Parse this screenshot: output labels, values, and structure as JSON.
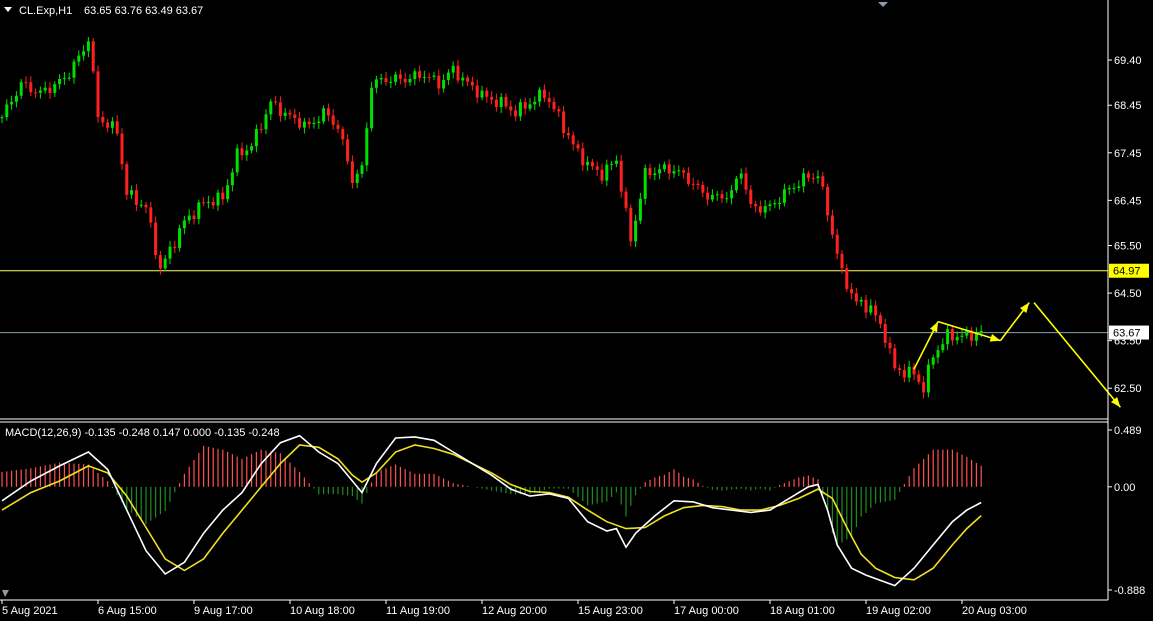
{
  "chart_header": {
    "symbol": "CL.Exp,H1",
    "ohlc": "63.65 63.76 63.49 63.67"
  },
  "macd_header": {
    "text": "MACD(12,26,9) -0.135 -0.248 0.147 0.000 -0.135 -0.248"
  },
  "colors": {
    "background": "#000000",
    "bull": "#00e000",
    "bear": "#ff2020",
    "hist_pos": "#ff5050",
    "hist_neg": "#1e8c1e",
    "macd_line": "#ffffff",
    "signal_line": "#f0e020",
    "hline": "#ffff66",
    "current_line": "#8aa0b0",
    "arrow": "#ffff00",
    "axis": "#ffffff"
  },
  "chart_data": [
    {
      "type": "candlestick",
      "timeframe": "H1",
      "ylim": [
        62.0,
        70.2
      ],
      "y_ticks": [
        "69.40",
        "68.45",
        "67.45",
        "66.45",
        "65.50",
        "64.50",
        "63.50",
        "62.50"
      ],
      "x_ticks": [
        "5 Aug 2021",
        "6 Aug 15:00",
        "9 Aug 17:00",
        "10 Aug 18:00",
        "11 Aug 19:00",
        "12 Aug 20:00",
        "15 Aug 23:00",
        "17 Aug 00:00",
        "18 Aug 01:00",
        "19 Aug 02:00",
        "20 Aug 03:00"
      ],
      "key_points": [
        {
          "t": 0.0,
          "v": 68.2
        },
        {
          "t": 4.0,
          "v": 68.9
        },
        {
          "t": 8.0,
          "v": 68.7
        },
        {
          "t": 13.0,
          "v": 69.0
        },
        {
          "t": 17.0,
          "v": 69.6
        },
        {
          "t": 18.0,
          "v": 69.9
        },
        {
          "t": 20.0,
          "v": 68.2
        },
        {
          "t": 24.0,
          "v": 67.9
        },
        {
          "t": 26.0,
          "v": 66.6
        },
        {
          "t": 30.0,
          "v": 66.3
        },
        {
          "t": 33.0,
          "v": 65.0
        },
        {
          "t": 35.0,
          "v": 65.4
        },
        {
          "t": 38.0,
          "v": 66.0
        },
        {
          "t": 42.0,
          "v": 66.4
        },
        {
          "t": 46.0,
          "v": 66.5
        },
        {
          "t": 49.0,
          "v": 67.4
        },
        {
          "t": 52.0,
          "v": 67.6
        },
        {
          "t": 56.0,
          "v": 68.5
        },
        {
          "t": 60.0,
          "v": 68.2
        },
        {
          "t": 64.0,
          "v": 68.0
        },
        {
          "t": 67.0,
          "v": 68.3
        },
        {
          "t": 70.0,
          "v": 68.0
        },
        {
          "t": 73.0,
          "v": 66.9
        },
        {
          "t": 75.0,
          "v": 67.1
        },
        {
          "t": 77.0,
          "v": 68.9
        },
        {
          "t": 80.0,
          "v": 69.0
        },
        {
          "t": 84.0,
          "v": 69.0
        },
        {
          "t": 88.0,
          "v": 69.1
        },
        {
          "t": 91.0,
          "v": 68.9
        },
        {
          "t": 94.0,
          "v": 69.2
        },
        {
          "t": 97.0,
          "v": 68.9
        },
        {
          "t": 101.0,
          "v": 68.6
        },
        {
          "t": 104.0,
          "v": 68.5
        },
        {
          "t": 107.0,
          "v": 68.3
        },
        {
          "t": 110.0,
          "v": 68.5
        },
        {
          "t": 113.0,
          "v": 68.7
        },
        {
          "t": 116.0,
          "v": 68.2
        },
        {
          "t": 119.0,
          "v": 67.6
        },
        {
          "t": 122.0,
          "v": 67.2
        },
        {
          "t": 125.0,
          "v": 67.0
        },
        {
          "t": 128.0,
          "v": 67.3
        },
        {
          "t": 131.0,
          "v": 65.6
        },
        {
          "t": 134.0,
          "v": 67.0
        },
        {
          "t": 137.0,
          "v": 67.1
        },
        {
          "t": 140.0,
          "v": 67.1
        },
        {
          "t": 143.0,
          "v": 66.9
        },
        {
          "t": 146.0,
          "v": 66.6
        },
        {
          "t": 149.0,
          "v": 66.5
        },
        {
          "t": 152.0,
          "v": 66.6
        },
        {
          "t": 154.0,
          "v": 67.1
        },
        {
          "t": 156.0,
          "v": 66.3
        },
        {
          "t": 160.0,
          "v": 66.3
        },
        {
          "t": 163.0,
          "v": 66.6
        },
        {
          "t": 167.0,
          "v": 66.9
        },
        {
          "t": 170.0,
          "v": 67.0
        },
        {
          "t": 172.0,
          "v": 66.2
        },
        {
          "t": 175.0,
          "v": 64.9
        },
        {
          "t": 178.0,
          "v": 64.3
        },
        {
          "t": 181.0,
          "v": 64.2
        },
        {
          "t": 184.0,
          "v": 63.6
        },
        {
          "t": 186.0,
          "v": 62.9
        },
        {
          "t": 190.0,
          "v": 62.8
        },
        {
          "t": 192.0,
          "v": 62.5
        },
        {
          "t": 194.0,
          "v": 63.2
        },
        {
          "t": 197.0,
          "v": 63.6
        },
        {
          "t": 201.0,
          "v": 63.6
        },
        {
          "t": 204.0,
          "v": 63.67
        }
      ],
      "horizontal_lines": [
        {
          "value": 64.97,
          "label": "64.97",
          "style": "yellow"
        },
        {
          "value": 63.67,
          "label": "63.67",
          "style": "current-price"
        }
      ],
      "projection_arrows": [
        [
          {
            "t": 190.0,
            "v": 62.9
          },
          {
            "t": 195.0,
            "v": 63.9
          }
        ],
        [
          {
            "t": 195.0,
            "v": 63.9
          },
          {
            "t": 208.0,
            "v": 63.5
          }
        ],
        [
          {
            "t": 208.0,
            "v": 63.5
          },
          {
            "t": 214.0,
            "v": 64.3
          }
        ],
        [
          {
            "t": 215.0,
            "v": 64.3
          },
          {
            "t": 233.0,
            "v": 62.1
          }
        ]
      ]
    },
    {
      "type": "line",
      "name": "MACD(12,26,9)",
      "ylim": [
        -0.888,
        0.489
      ],
      "y_ticks": [
        "0.489",
        "0.00",
        "-0.888"
      ],
      "macd_points": [
        {
          "t": 0,
          "v": -0.12
        },
        {
          "t": 6,
          "v": 0.05
        },
        {
          "t": 12,
          "v": 0.18
        },
        {
          "t": 18,
          "v": 0.3
        },
        {
          "t": 22,
          "v": 0.15
        },
        {
          "t": 26,
          "v": -0.2
        },
        {
          "t": 30,
          "v": -0.55
        },
        {
          "t": 34,
          "v": -0.75
        },
        {
          "t": 38,
          "v": -0.65
        },
        {
          "t": 42,
          "v": -0.4
        },
        {
          "t": 46,
          "v": -0.2
        },
        {
          "t": 50,
          "v": -0.05
        },
        {
          "t": 54,
          "v": 0.2
        },
        {
          "t": 58,
          "v": 0.38
        },
        {
          "t": 62,
          "v": 0.44
        },
        {
          "t": 66,
          "v": 0.3
        },
        {
          "t": 70,
          "v": 0.2
        },
        {
          "t": 73,
          "v": 0.05
        },
        {
          "t": 75,
          "v": -0.05
        },
        {
          "t": 78,
          "v": 0.2
        },
        {
          "t": 82,
          "v": 0.42
        },
        {
          "t": 86,
          "v": 0.43
        },
        {
          "t": 90,
          "v": 0.4
        },
        {
          "t": 94,
          "v": 0.3
        },
        {
          "t": 98,
          "v": 0.2
        },
        {
          "t": 102,
          "v": 0.1
        },
        {
          "t": 106,
          "v": -0.02
        },
        {
          "t": 110,
          "v": -0.08
        },
        {
          "t": 114,
          "v": -0.06
        },
        {
          "t": 118,
          "v": -0.1
        },
        {
          "t": 122,
          "v": -0.3
        },
        {
          "t": 126,
          "v": -0.38
        },
        {
          "t": 128,
          "v": -0.36
        },
        {
          "t": 130,
          "v": -0.52
        },
        {
          "t": 132,
          "v": -0.4
        },
        {
          "t": 136,
          "v": -0.25
        },
        {
          "t": 140,
          "v": -0.12
        },
        {
          "t": 144,
          "v": -0.13
        },
        {
          "t": 148,
          "v": -0.18
        },
        {
          "t": 152,
          "v": -0.2
        },
        {
          "t": 156,
          "v": -0.22
        },
        {
          "t": 160,
          "v": -0.2
        },
        {
          "t": 164,
          "v": -0.1
        },
        {
          "t": 168,
          "v": 0.0
        },
        {
          "t": 170,
          "v": 0.02
        },
        {
          "t": 172,
          "v": -0.2
        },
        {
          "t": 174,
          "v": -0.5
        },
        {
          "t": 177,
          "v": -0.7
        },
        {
          "t": 180,
          "v": -0.76
        },
        {
          "t": 184,
          "v": -0.82
        },
        {
          "t": 186,
          "v": -0.85
        },
        {
          "t": 190,
          "v": -0.7
        },
        {
          "t": 194,
          "v": -0.5
        },
        {
          "t": 198,
          "v": -0.3
        },
        {
          "t": 201,
          "v": -0.2
        },
        {
          "t": 204,
          "v": -0.135
        }
      ],
      "signal_points": [
        {
          "t": 0,
          "v": -0.2
        },
        {
          "t": 6,
          "v": -0.05
        },
        {
          "t": 12,
          "v": 0.05
        },
        {
          "t": 18,
          "v": 0.18
        },
        {
          "t": 22,
          "v": 0.12
        },
        {
          "t": 26,
          "v": -0.08
        },
        {
          "t": 30,
          "v": -0.35
        },
        {
          "t": 34,
          "v": -0.62
        },
        {
          "t": 38,
          "v": -0.72
        },
        {
          "t": 42,
          "v": -0.62
        },
        {
          "t": 46,
          "v": -0.4
        },
        {
          "t": 50,
          "v": -0.2
        },
        {
          "t": 54,
          "v": 0.0
        },
        {
          "t": 58,
          "v": 0.2
        },
        {
          "t": 62,
          "v": 0.36
        },
        {
          "t": 66,
          "v": 0.34
        },
        {
          "t": 70,
          "v": 0.24
        },
        {
          "t": 73,
          "v": 0.1
        },
        {
          "t": 75,
          "v": 0.04
        },
        {
          "t": 78,
          "v": 0.12
        },
        {
          "t": 82,
          "v": 0.3
        },
        {
          "t": 86,
          "v": 0.36
        },
        {
          "t": 90,
          "v": 0.33
        },
        {
          "t": 94,
          "v": 0.28
        },
        {
          "t": 98,
          "v": 0.2
        },
        {
          "t": 102,
          "v": 0.12
        },
        {
          "t": 106,
          "v": 0.02
        },
        {
          "t": 110,
          "v": -0.04
        },
        {
          "t": 114,
          "v": -0.05
        },
        {
          "t": 118,
          "v": -0.09
        },
        {
          "t": 122,
          "v": -0.2
        },
        {
          "t": 126,
          "v": -0.3
        },
        {
          "t": 130,
          "v": -0.36
        },
        {
          "t": 134,
          "v": -0.35
        },
        {
          "t": 138,
          "v": -0.25
        },
        {
          "t": 142,
          "v": -0.18
        },
        {
          "t": 146,
          "v": -0.16
        },
        {
          "t": 150,
          "v": -0.17
        },
        {
          "t": 154,
          "v": -0.2
        },
        {
          "t": 158,
          "v": -0.2
        },
        {
          "t": 162,
          "v": -0.16
        },
        {
          "t": 166,
          "v": -0.1
        },
        {
          "t": 170,
          "v": -0.02
        },
        {
          "t": 173,
          "v": -0.1
        },
        {
          "t": 176,
          "v": -0.35
        },
        {
          "t": 179,
          "v": -0.58
        },
        {
          "t": 182,
          "v": -0.7
        },
        {
          "t": 186,
          "v": -0.78
        },
        {
          "t": 190,
          "v": -0.8
        },
        {
          "t": 194,
          "v": -0.7
        },
        {
          "t": 198,
          "v": -0.5
        },
        {
          "t": 201,
          "v": -0.36
        },
        {
          "t": 204,
          "v": -0.248
        }
      ]
    }
  ]
}
